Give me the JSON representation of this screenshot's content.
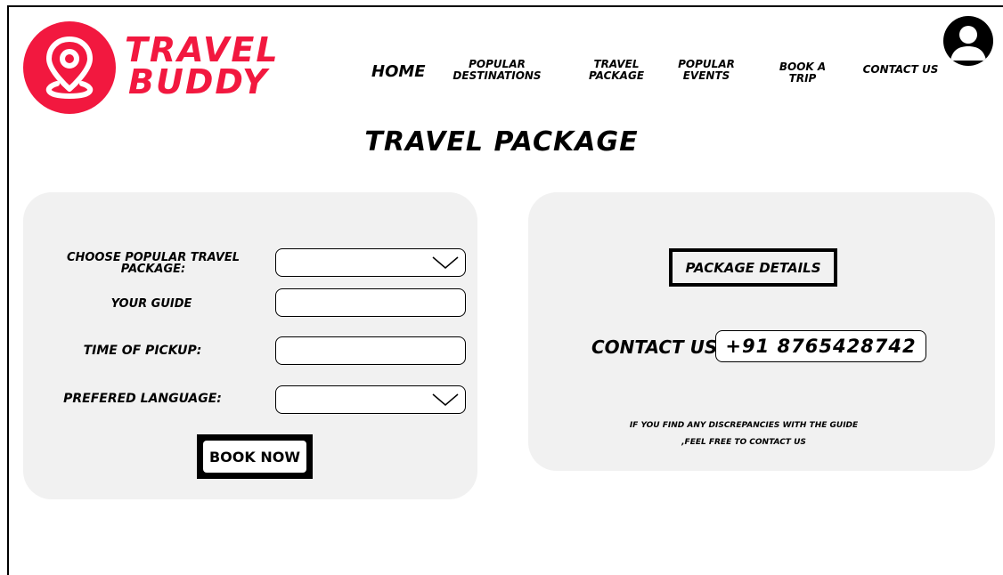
{
  "brand": {
    "line1": "TRAVEL",
    "line2": "BUDDY",
    "color": "#f2183f"
  },
  "nav": {
    "home": "HOME",
    "popular_destinations": [
      "POPULAR",
      "DESTINATIONS"
    ],
    "travel_package": [
      "TRAVEL",
      "PACKAGE"
    ],
    "popular_events": [
      "POPULAR",
      "EVENTS"
    ],
    "book_a_trip": [
      "BOOK A",
      "TRIP"
    ],
    "contact_us": "CONTACT US"
  },
  "page_title": "TRAVEL PACKAGE",
  "form": {
    "package_label": [
      "CHOOSE POPULAR TRAVEL",
      "PACKAGE:"
    ],
    "package_value": "",
    "guide_label": "YOUR GUIDE",
    "guide_value": "",
    "pickup_label": "TIME OF PICKUP:",
    "pickup_value": "",
    "language_label": "PREFERED LANGUAGE:",
    "language_value": "",
    "book_button": "BOOK NOW"
  },
  "details": {
    "package_details_label": "PACKAGE DETAILS",
    "contact_label": "CONTACT US:",
    "contact_phone": "+91 8765428742",
    "note_line1": "IF YOU FIND ANY DISCREPANCIES WITH THE GUIDE",
    "note_line2": ",FEEL FREE TO CONTACT US"
  },
  "panel_color": "#f1f1f1"
}
